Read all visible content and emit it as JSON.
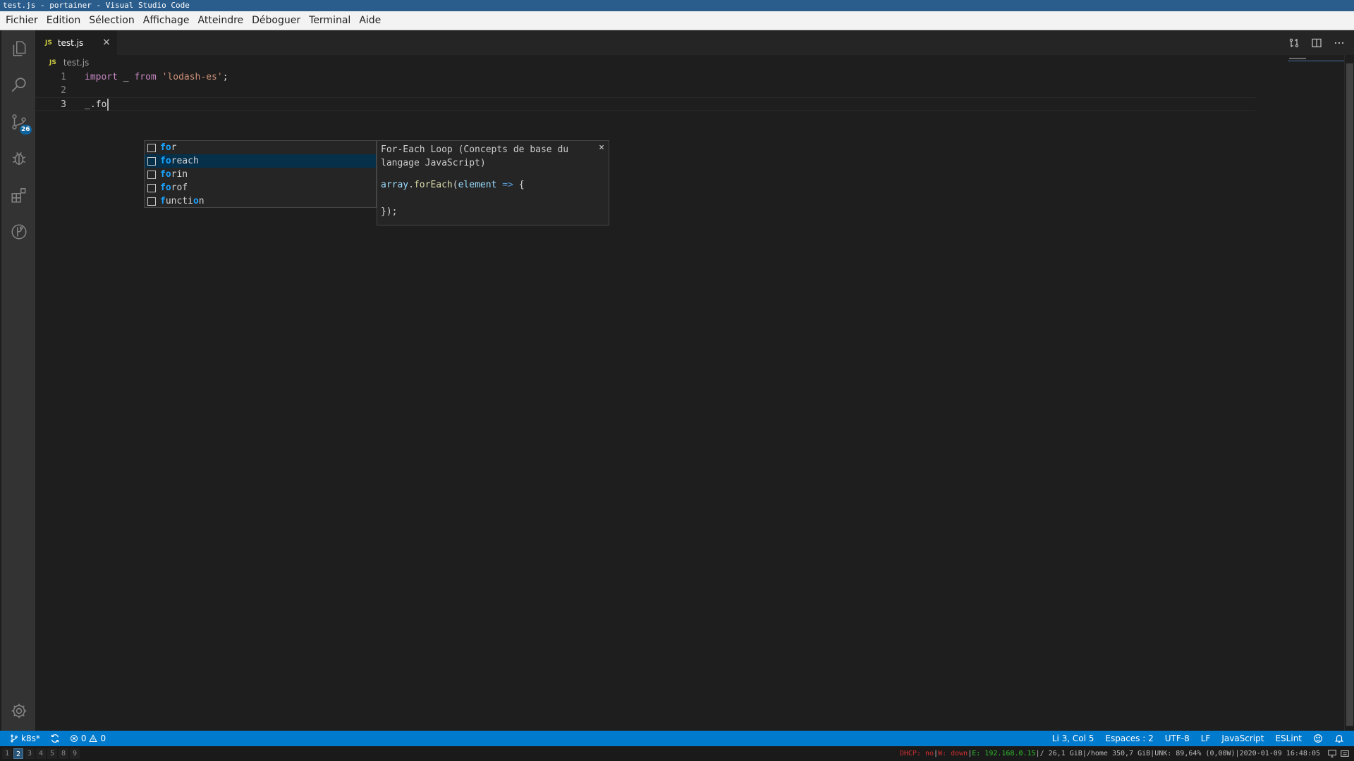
{
  "window_title": "test.js - portainer - Visual Studio Code",
  "menu": [
    "Fichier",
    "Edition",
    "Sélection",
    "Affichage",
    "Atteindre",
    "Déboguer",
    "Terminal",
    "Aide"
  ],
  "activity_bar": {
    "items": [
      "explorer-icon",
      "search-icon",
      "source-control-icon",
      "debug-icon",
      "extensions-icon",
      "gitlens-icon"
    ],
    "scm_badge": "26",
    "settings": "gear-icon"
  },
  "tab": {
    "icon": "JS",
    "name": "test.js",
    "close": "×"
  },
  "breadcrumb": {
    "icon": "JS",
    "file": "test.js"
  },
  "lines": [
    {
      "num": "1",
      "parts": [
        [
          "kw",
          "import"
        ],
        [
          "pl",
          " _ "
        ],
        [
          "kw",
          "from"
        ],
        [
          "pl",
          " "
        ],
        [
          "str",
          "'lodash-es'"
        ],
        [
          "pl",
          ";"
        ]
      ]
    },
    {
      "num": "2",
      "parts": []
    },
    {
      "num": "3",
      "parts": [
        [
          "pl",
          "_.fo"
        ]
      ]
    }
  ],
  "suggestions": [
    {
      "match": "fo",
      "rest": "r",
      "selected": false
    },
    {
      "match": "fo",
      "rest": "reach",
      "selected": true
    },
    {
      "match": "fo",
      "rest": "rin",
      "selected": false
    },
    {
      "match": "fo",
      "rest": "rof",
      "selected": false
    },
    {
      "label_segments": [
        [
          "f",
          true
        ],
        [
          "uncti",
          false
        ],
        [
          "o",
          true
        ],
        [
          "n",
          false
        ]
      ],
      "selected": false
    }
  ],
  "details": {
    "title": "For-Each Loop (Concepts de base du langage JavaScript)",
    "code_line1_var": "array",
    "code_line1_dot": ".",
    "code_line1_fn": "forEach",
    "code_line1_paren": "(",
    "code_line1_param": "element",
    "code_line1_arrow": "=>",
    "code_line1_brace": "{",
    "code_line3": "});",
    "close": "×"
  },
  "status_bar": {
    "branch": "k8s*",
    "errors": "0",
    "warnings": "0",
    "position": "Li 3, Col 5",
    "indent": "Espaces : 2",
    "encoding": "UTF-8",
    "eol": "LF",
    "language": "JavaScript",
    "linter": "ESLint"
  },
  "taskbar": {
    "workspaces": [
      "1",
      "2",
      "3",
      "4",
      "5",
      "8",
      "9"
    ],
    "active_workspace": "2",
    "dhcp": "DHCP: no",
    "wifi": "W: down",
    "ethernet": "E: 192.168.0.15",
    "disk_root": "/ 26,1 GiB",
    "disk_home": "/home 350,7 GiB",
    "battery": "UNK: 89,64% (0,00W)",
    "datetime": "2020-01-09 16:48:05",
    "separator": "|"
  },
  "colors": {
    "statusbar": "#007acc",
    "activitybar": "#333333",
    "editor": "#1e1e1e",
    "selection": "#062f4a",
    "highlight": "#18a3ff"
  }
}
